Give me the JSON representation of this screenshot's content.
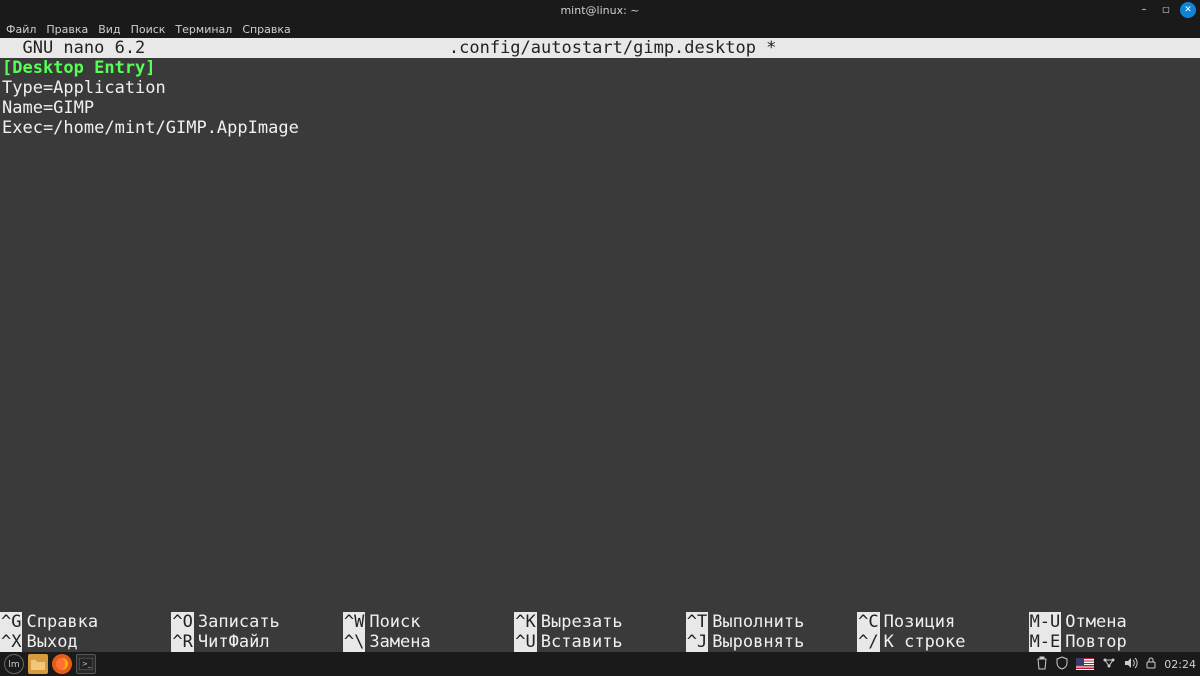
{
  "titlebar": {
    "title": "mint@linux: ~"
  },
  "menubar": {
    "items": [
      "Файл",
      "Правка",
      "Вид",
      "Поиск",
      "Терминал",
      "Справка"
    ]
  },
  "nano": {
    "header_left": "  GNU nano 6.2",
    "header_center": ".config/autostart/gimp.desktop *",
    "section": "[Desktop Entry]",
    "lines": [
      "Type=Application",
      "Name=GIMP",
      "Exec=/home/mint/GIMP.AppImage"
    ],
    "shortcuts_row1": [
      {
        "key": "^G",
        "label": "Справка"
      },
      {
        "key": "^O",
        "label": "Записать"
      },
      {
        "key": "^W",
        "label": "Поиск"
      },
      {
        "key": "^K",
        "label": "Вырезать"
      },
      {
        "key": "^T",
        "label": "Выполнить"
      },
      {
        "key": "^C",
        "label": "Позиция"
      },
      {
        "key": "M-U",
        "label": "Отмена"
      }
    ],
    "shortcuts_row2": [
      {
        "key": "^X",
        "label": "Выход"
      },
      {
        "key": "^R",
        "label": "ЧитФайл"
      },
      {
        "key": "^\\",
        "label": "Замена"
      },
      {
        "key": "^U",
        "label": "Вставить"
      },
      {
        "key": "^J",
        "label": "Выровнять"
      },
      {
        "key": "^/",
        "label": "К строке"
      },
      {
        "key": "M-E",
        "label": "Повтор"
      }
    ]
  },
  "taskbar": {
    "clock": "02:24",
    "tray_icons": [
      "trash-icon",
      "shield-icon",
      "flag-icon",
      "network-icon",
      "volume-icon",
      "lock-icon"
    ]
  }
}
